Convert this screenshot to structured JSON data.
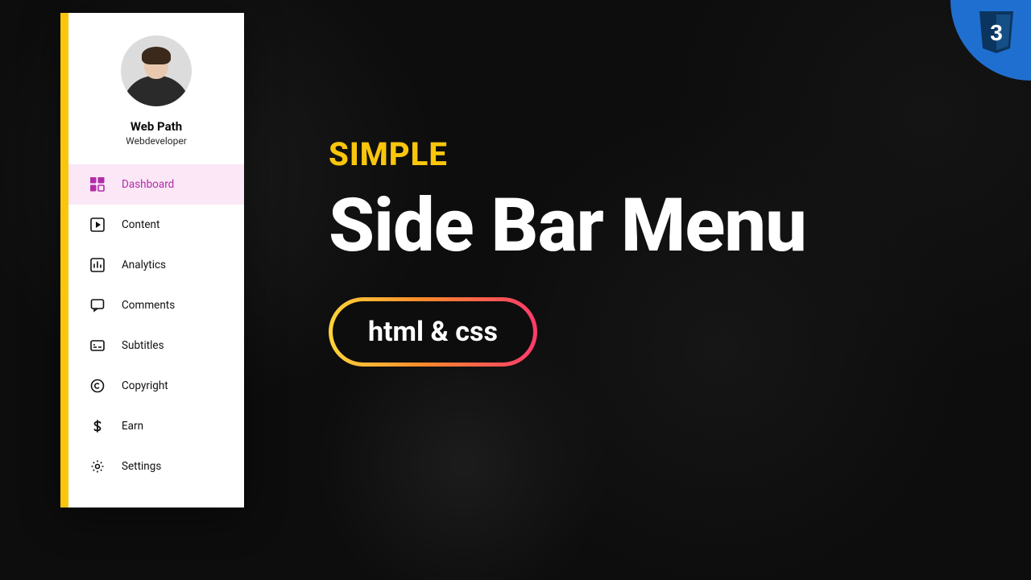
{
  "badge": {
    "text": "3"
  },
  "sidebar": {
    "profile": {
      "name": "Web Path",
      "role": "Webdeveloper"
    },
    "items": [
      {
        "label": "Dashboard",
        "icon": "dashboard-icon",
        "active": true
      },
      {
        "label": "Content",
        "icon": "play-icon"
      },
      {
        "label": "Analytics",
        "icon": "chart-icon"
      },
      {
        "label": "Comments",
        "icon": "comment-icon"
      },
      {
        "label": "Subtitles",
        "icon": "subtitles-icon"
      },
      {
        "label": "Copyright",
        "icon": "copyright-icon"
      },
      {
        "label": "Earn",
        "icon": "dollar-icon"
      },
      {
        "label": "Settings",
        "icon": "gear-icon"
      }
    ]
  },
  "headline": {
    "kicker": "SIMPLE",
    "title": "Side Bar Menu",
    "pill": "html & css"
  },
  "colors": {
    "accent_yellow": "#f9c60b",
    "active_bg": "#fbe7f6",
    "active_fg": "#b12da8",
    "badge_blue": "#1f6fd0"
  }
}
